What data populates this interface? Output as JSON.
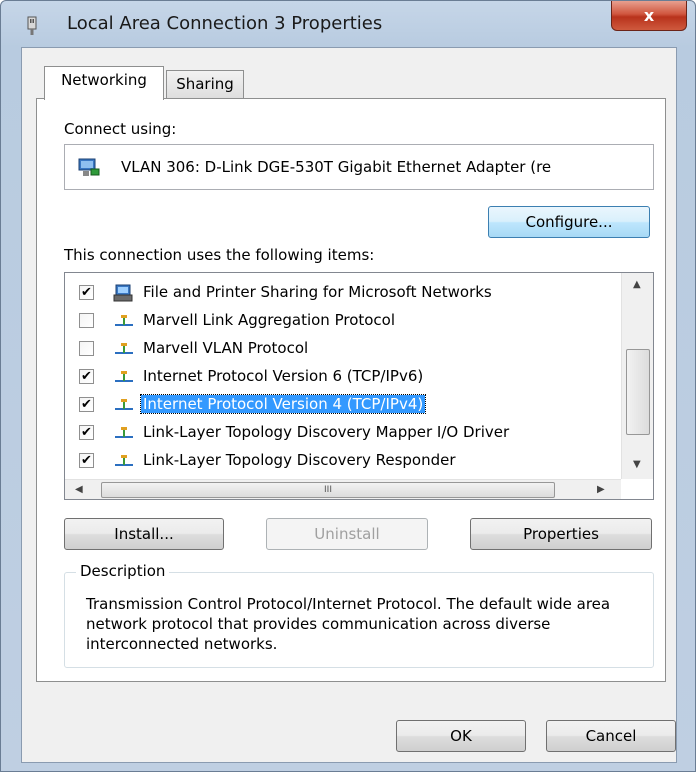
{
  "window": {
    "title": "Local Area Connection 3 Properties",
    "close_label": "x"
  },
  "tabs": [
    {
      "label": "Networking",
      "active": true
    },
    {
      "label": "Sharing",
      "active": false
    }
  ],
  "connect_using": {
    "label": "Connect using:",
    "adapter": "VLAN 306: D-Link DGE-530T Gigabit Ethernet Adapter (re"
  },
  "buttons": {
    "configure": "Configure...",
    "install": "Install...",
    "uninstall": "Uninstall",
    "properties": "Properties",
    "ok": "OK",
    "cancel": "Cancel"
  },
  "items_label": "This connection uses the following items:",
  "items": [
    {
      "label": "File and Printer Sharing for Microsoft Networks",
      "checked": true,
      "icon": "printer-share-icon",
      "checkmark": "✔"
    },
    {
      "label": "Marvell Link Aggregation Protocol",
      "checked": false,
      "icon": "protocol-icon",
      "checkmark": ""
    },
    {
      "label": "Marvell VLAN Protocol",
      "checked": false,
      "icon": "protocol-icon",
      "checkmark": ""
    },
    {
      "label": "Internet Protocol Version 6 (TCP/IPv6)",
      "checked": true,
      "icon": "protocol-icon",
      "checkmark": "✔"
    },
    {
      "label": "Internet Protocol Version 4 (TCP/IPv4)",
      "checked": true,
      "icon": "protocol-icon",
      "checkmark": "✔",
      "selected": true
    },
    {
      "label": "Link-Layer Topology Discovery Mapper I/O Driver",
      "checked": true,
      "icon": "protocol-icon",
      "checkmark": "✔"
    },
    {
      "label": "Link-Layer Topology Discovery Responder",
      "checked": true,
      "icon": "protocol-icon",
      "checkmark": "✔"
    }
  ],
  "hscroll_grip": "III",
  "description": {
    "legend": "Description",
    "text": "Transmission Control Protocol/Internet Protocol. The default wide area network protocol that provides communication across diverse interconnected networks."
  },
  "colors": {
    "selection": "#3399ff",
    "close_button": "#c4402a"
  }
}
